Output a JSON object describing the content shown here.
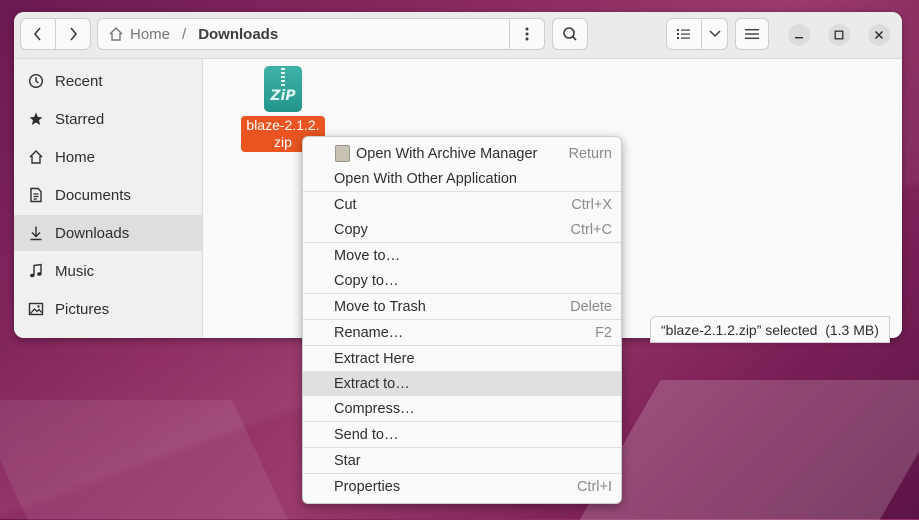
{
  "window": {
    "nav": {
      "back_icon": "chevron-left-icon",
      "forward_icon": "chevron-right-icon"
    },
    "path": {
      "home_label": "Home",
      "separator": "/",
      "current": "Downloads"
    },
    "header_buttons": [
      "path-menu-icon",
      "search-icon",
      "list-view-icon",
      "view-options-icon",
      "main-menu-icon"
    ],
    "window_controls": [
      "minimize-icon",
      "maximize-icon",
      "close-icon"
    ]
  },
  "sidebar": {
    "items": [
      {
        "label": "Recent",
        "icon": "clock-icon"
      },
      {
        "label": "Starred",
        "icon": "star-icon"
      },
      {
        "label": "Home",
        "icon": "home-icon"
      },
      {
        "label": "Documents",
        "icon": "document-icon"
      },
      {
        "label": "Downloads",
        "icon": "download-icon",
        "active": true
      },
      {
        "label": "Music",
        "icon": "music-icon"
      },
      {
        "label": "Pictures",
        "icon": "picture-icon"
      }
    ]
  },
  "files": [
    {
      "name": "blaze-2.1.2.zip",
      "name_line1": "blaze-2.1.2.",
      "name_line2": "zip",
      "icon_text": "ZiP",
      "selected": true
    }
  ],
  "statusbar": {
    "text": "“blaze-2.1.2.zip” selected  (1.3 MB)"
  },
  "context_menu": {
    "items": [
      {
        "label": "Open With Archive Manager",
        "accel": "Return",
        "icon": "archive-manager-icon"
      },
      {
        "label": "Open With Other Application",
        "accel": ""
      },
      {
        "label": "Cut",
        "accel": "Ctrl+X"
      },
      {
        "label": "Copy",
        "accel": "Ctrl+C"
      },
      {
        "label": "Move to…",
        "accel": ""
      },
      {
        "label": "Copy to…",
        "accel": ""
      },
      {
        "label": "Move to Trash",
        "accel": "Delete"
      },
      {
        "label": "Rename…",
        "accel": "F2"
      },
      {
        "label": "Extract Here",
        "accel": ""
      },
      {
        "label": "Extract to…",
        "accel": "",
        "hovered": true
      },
      {
        "label": "Compress…",
        "accel": ""
      },
      {
        "label": "Send to…",
        "accel": ""
      },
      {
        "label": "Star",
        "accel": ""
      },
      {
        "label": "Properties",
        "accel": "Ctrl+I"
      }
    ]
  },
  "colors": {
    "accent": "#e95420",
    "zip_icon": "#2aa198",
    "desktop": "#8c2a62"
  }
}
